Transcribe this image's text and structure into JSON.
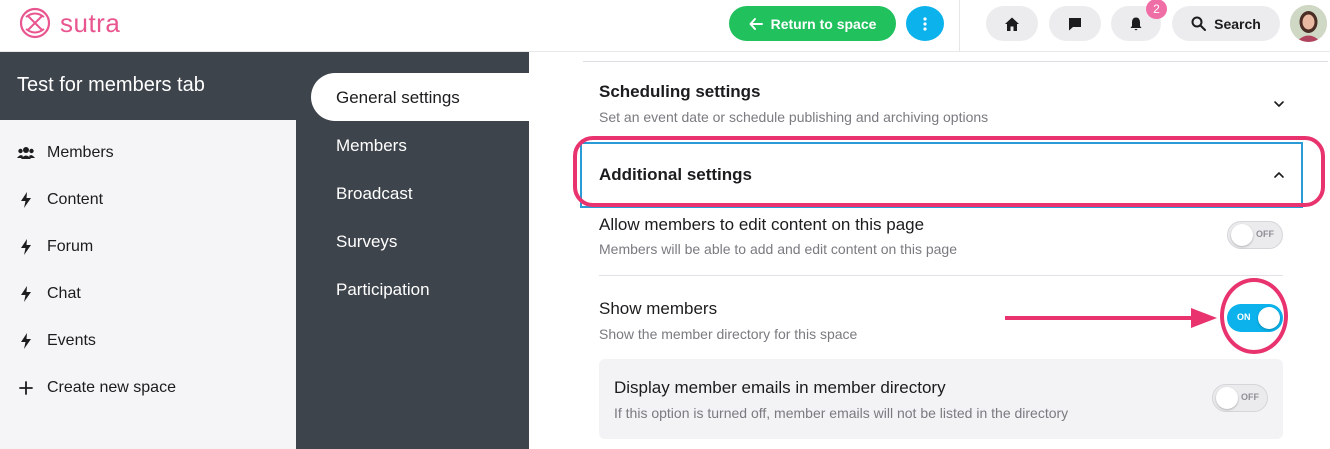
{
  "brand": {
    "name": "sutra",
    "color": "#e8558f"
  },
  "topbar": {
    "return_label": "Return to space",
    "notification_count": "2",
    "search_label": "Search"
  },
  "sidebar": {
    "space_title": "Test for members tab",
    "items": [
      {
        "label": "Members",
        "icon": "users-icon"
      },
      {
        "label": "Content",
        "icon": "bolt-icon"
      },
      {
        "label": "Forum",
        "icon": "bolt-icon"
      },
      {
        "label": "Chat",
        "icon": "bolt-icon"
      },
      {
        "label": "Events",
        "icon": "bolt-icon"
      },
      {
        "label": "Create new space",
        "icon": "plus-icon"
      }
    ]
  },
  "settings_nav": {
    "active": "General settings",
    "items": [
      "Members",
      "Broadcast",
      "Surveys",
      "Participation"
    ]
  },
  "main": {
    "scheduling": {
      "title": "Scheduling settings",
      "desc": "Set an event date or schedule publishing and archiving options"
    },
    "additional": {
      "title": "Additional settings"
    },
    "options": {
      "edit": {
        "title": "Allow members to edit content on this page",
        "desc": "Members will be able to add and edit content on this page",
        "state": "OFF"
      },
      "show_members": {
        "title": "Show members",
        "desc": "Show the member directory for this space",
        "state": "ON"
      },
      "emails": {
        "title": "Display member emails in member directory",
        "desc": "If this option is turned off, member emails will not be listed in the directory",
        "state": "OFF"
      }
    }
  },
  "colors": {
    "green": "#21c25e",
    "blue": "#0cb2ec",
    "dark": "#3e444b",
    "highlight": "#e8336e"
  }
}
